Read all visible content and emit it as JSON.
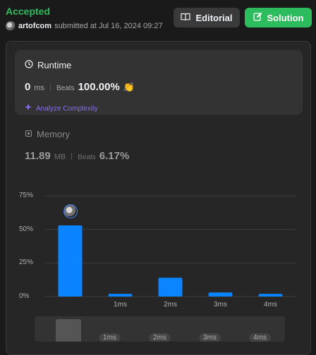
{
  "header": {
    "status": "Accepted",
    "username": "artofcom",
    "submitted_text": "submitted at Jul 16, 2024 09:27"
  },
  "buttons": {
    "editorial": "Editorial",
    "solution": "Solution"
  },
  "runtime": {
    "title": "Runtime",
    "value": "0",
    "unit": "ms",
    "beats_label": "Beats",
    "beats_value": "100.00%",
    "analyze_label": "Analyze Complexity"
  },
  "memory": {
    "title": "Memory",
    "value": "11.89",
    "unit": "MB",
    "beats_label": "Beats",
    "beats_value": "6.17%"
  },
  "chart_data": {
    "type": "bar",
    "y_ticks": [
      "75%",
      "50%",
      "25%",
      "0%"
    ],
    "ylim": [
      0,
      75
    ],
    "categories": [
      "0ms",
      "1ms",
      "2ms",
      "3ms",
      "4ms"
    ],
    "x_tick_labels": [
      "",
      "1ms",
      "2ms",
      "3ms",
      "4ms"
    ],
    "values": [
      53,
      2,
      14,
      3,
      2
    ],
    "highlight_index": 0,
    "bar_color": "#0a84ff",
    "grid": true
  },
  "navigator": {
    "labels": [
      "1ms",
      "2ms",
      "3ms",
      "4ms"
    ]
  },
  "colors": {
    "accepted": "#2cbb5d",
    "analyze": "#8b6cf6"
  }
}
